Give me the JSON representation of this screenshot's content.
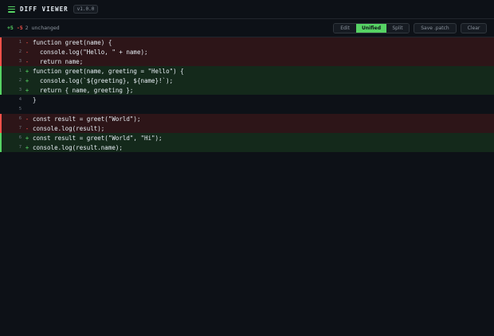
{
  "header": {
    "title": "DIFF VIEWER",
    "version": "v1.0.0"
  },
  "toolbar": {
    "added": "+5",
    "removed": "-5",
    "unchanged": "2 unchanged",
    "modes": [
      "Edit",
      "Unified",
      "Split"
    ],
    "active_mode": "Unified",
    "save_label": "Save .patch",
    "clear_label": "Clear"
  },
  "colors": {
    "accent": "#56d364",
    "removed": "#f85149",
    "removed_bg": "#2d1518",
    "added_bg": "#14291b",
    "background": "#0d1117"
  },
  "diff": [
    {
      "type": "del",
      "line": "1",
      "sign": "-",
      "code": "function greet(name) {"
    },
    {
      "type": "del",
      "line": "2",
      "sign": "-",
      "code": "  console.log(\"Hello, \" + name);"
    },
    {
      "type": "del",
      "line": "3",
      "sign": "-",
      "code": "  return name;"
    },
    {
      "type": "add",
      "line": "1",
      "sign": "+",
      "code": "function greet(name, greeting = \"Hello\") {"
    },
    {
      "type": "add",
      "line": "2",
      "sign": "+",
      "code": "  console.log(`${greeting}, ${name}!`);"
    },
    {
      "type": "add",
      "line": "3",
      "sign": "+",
      "code": "  return { name, greeting };"
    },
    {
      "type": "ctx",
      "line": "4",
      "sign": "",
      "code": "}"
    },
    {
      "type": "ctx",
      "line": "5",
      "sign": "",
      "code": ""
    },
    {
      "type": "del",
      "line": "6",
      "sign": "-",
      "code": "const result = greet(\"World\");"
    },
    {
      "type": "del",
      "line": "7",
      "sign": "-",
      "code": "console.log(result);"
    },
    {
      "type": "add",
      "line": "6",
      "sign": "+",
      "code": "const result = greet(\"World\", \"Hi\");"
    },
    {
      "type": "add",
      "line": "7",
      "sign": "+",
      "code": "console.log(result.name);"
    }
  ]
}
